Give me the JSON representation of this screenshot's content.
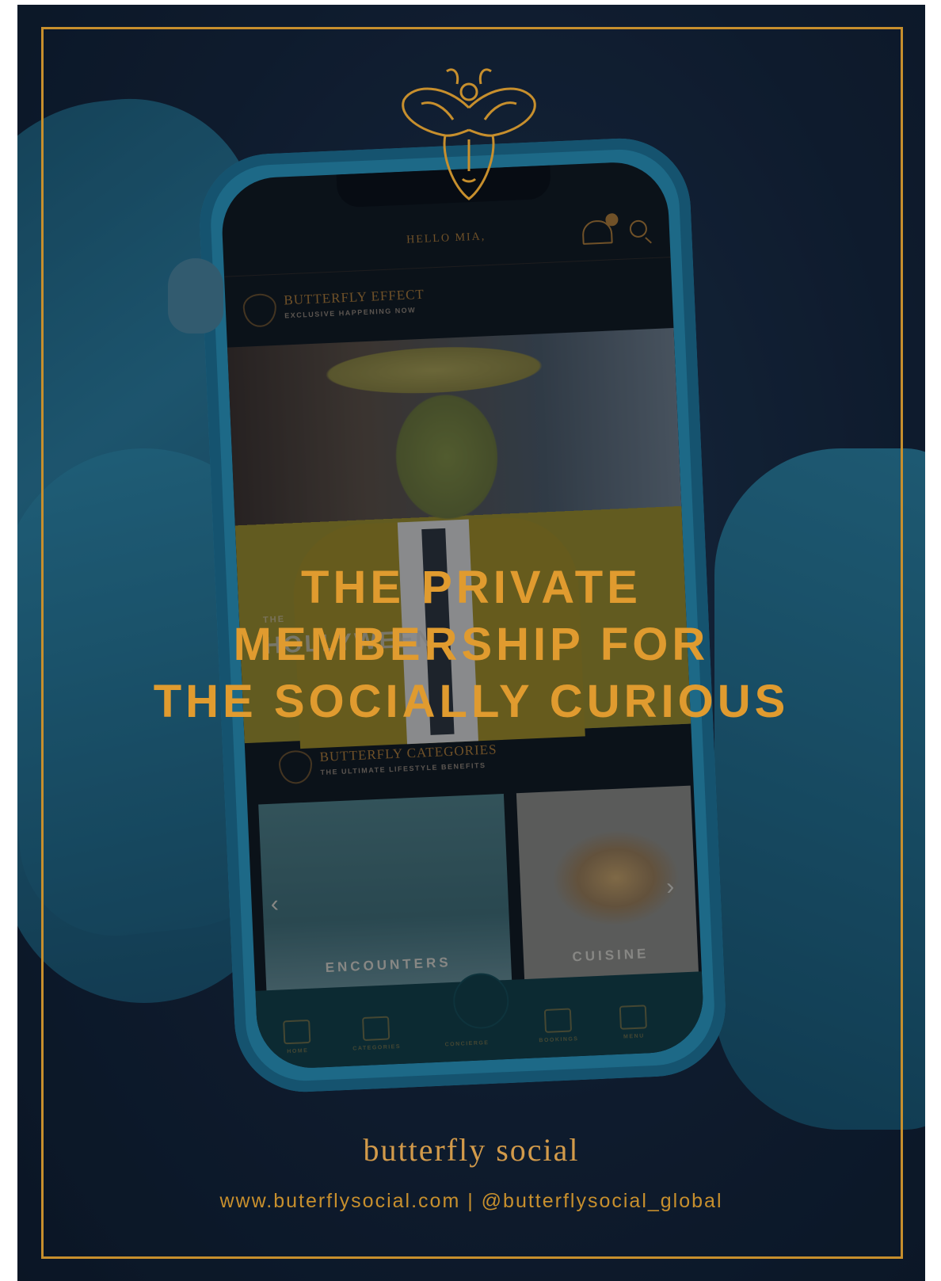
{
  "colors": {
    "accent_gold": "#e09b2f",
    "frame_gold": "#c78f2d",
    "background_navy": "#132338",
    "phone_case": "#2aa0c8"
  },
  "icons": {
    "logo": "butterfly-mask-logo",
    "bell": "concierge-bell-icon",
    "search": "search-icon"
  },
  "phone": {
    "greeting": "HELLO MIA,",
    "badge_count": "",
    "featured_section": {
      "title": "BUTTERFLY EFFECT",
      "subtitle": "EXCLUSIVE HAPPENING NOW"
    },
    "feature_captions": {
      "line1": "THE",
      "line2": "HOLLYWEEN"
    },
    "categories_section": {
      "title": "BUTTERFLY CATEGORIES",
      "subtitle": "THE ULTIMATE LIFESTYLE BENEFITS"
    },
    "cards": [
      {
        "label": "ENCOUNTERS"
      },
      {
        "label": "CUISINE"
      }
    ],
    "tabs": [
      {
        "label": "HOME"
      },
      {
        "label": "CATEGORIES"
      },
      {
        "label": "CONCIERGE"
      },
      {
        "label": "BOOKINGS"
      },
      {
        "label": "MENU"
      }
    ]
  },
  "headline": {
    "line1": "THE PRIVATE",
    "line2": "MEMBERSHIP FOR",
    "line3": "THE SOCIALLY CURIOUS"
  },
  "brand_name": "butterfly social",
  "contact": "www.buterflysocial.com | @butterflysocial_global"
}
